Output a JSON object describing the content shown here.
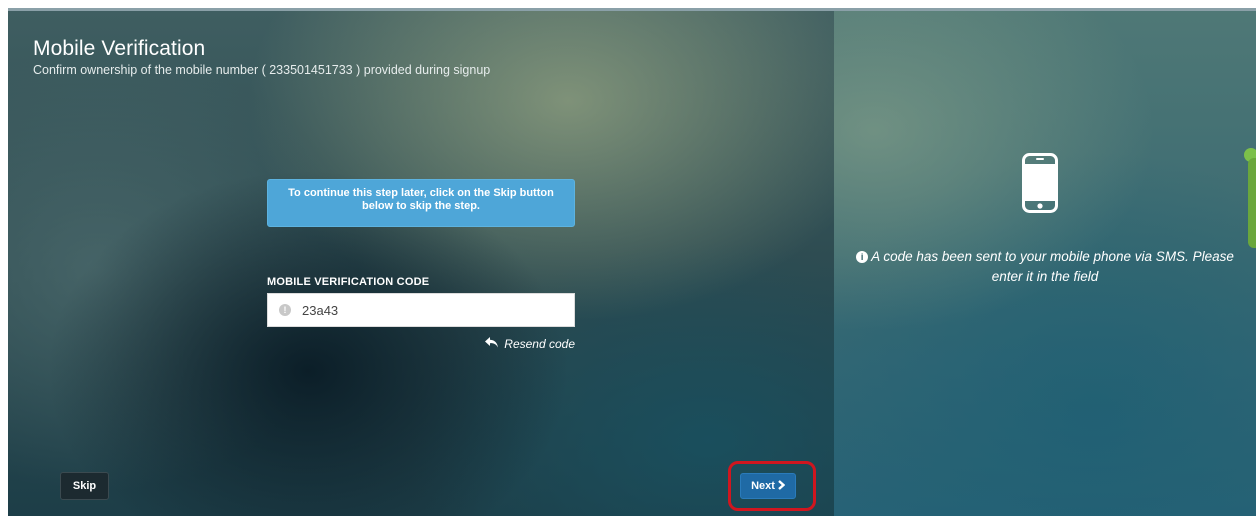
{
  "header": {
    "title": "Mobile Verification",
    "subtitle": "Confirm ownership of the mobile number ( 233501451733 ) provided during signup"
  },
  "alert": {
    "text_before": "To continue this step later, click on the ",
    "text_bold": "Skip",
    "text_after": " button below to skip the step."
  },
  "form": {
    "code_label": "MOBILE VERIFICATION CODE",
    "code_value": "23a43",
    "resend_label": "Resend code"
  },
  "actions": {
    "skip_label": "Skip",
    "next_label": "Next"
  },
  "side": {
    "sms_notice": "A code has been sent to your mobile phone via SMS. Please enter it in the field"
  },
  "icons": {
    "input_status": "exclamation-circle-icon",
    "resend": "reply-icon",
    "next": "chevron-right-icon",
    "phone": "mobile-phone-icon",
    "info": "info-circle-icon"
  },
  "colors": {
    "alert_bg": "#4ea6d8",
    "next_button": "#1f6aa5",
    "skip_button": "#1c2a30",
    "highlight": "#d0161f"
  }
}
